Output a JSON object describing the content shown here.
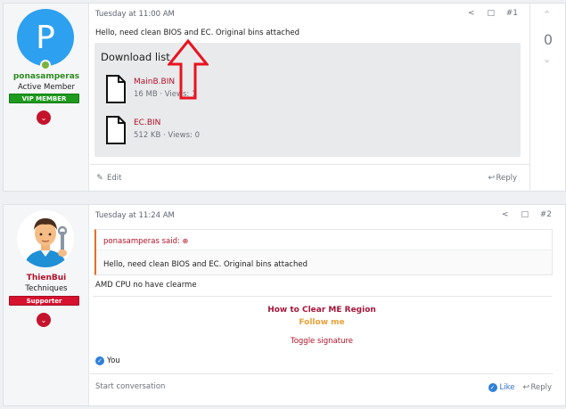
{
  "posts": [
    {
      "author": {
        "initial": "P",
        "name": "ponasamperas",
        "title": "Active Member",
        "banner": "VIP MEMBER",
        "name_color": "#2e8b1f",
        "banner_color": "#1e9a1e"
      },
      "date": "Tuesday at 11:00 AM",
      "number": "#1",
      "text": "Hello, need clean BIOS and EC. Original bins attached",
      "download_title": "Download list",
      "files": [
        {
          "name": "MainB.BIN",
          "meta": "16 MB · Views: 1"
        },
        {
          "name": "EC.BIN",
          "meta": "512 KB · Views: 0"
        }
      ],
      "edit_label": "Edit",
      "reply_label": "Reply",
      "vote_count": "0"
    },
    {
      "author": {
        "name": "ThienBui",
        "title": "Techniques",
        "banner": "Supporter",
        "name_color": "#b01228",
        "banner_color": "#d6122e"
      },
      "date": "Tuesday at 11:24 AM",
      "number": "#2",
      "quote_author": "ponasamperas said:",
      "quote_text": "Hello, need clean BIOS and EC. Original bins attached",
      "text": "AMD CPU no have clearme",
      "sig_title": "How to Clear ME Region",
      "sig_follow": "Follow me",
      "toggle_signature": "Toggle signature",
      "reactions": "You",
      "start_conversation": "Start conversation",
      "like_label": "Like",
      "reply_label": "Reply"
    }
  ],
  "colors": {
    "accent_red": "#b01228",
    "follow_orange": "#e8a23a",
    "arrow_red": "#e8131f"
  },
  "icons": {
    "share": "share-icon",
    "bookmark": "bookmark-icon",
    "edit": "pencil-icon",
    "reply": "reply-icon",
    "file": "file-icon",
    "like": "thumbs-up-icon",
    "expand": "chevron-down-icon",
    "quote_jump": "arrow-up-circle-icon"
  }
}
